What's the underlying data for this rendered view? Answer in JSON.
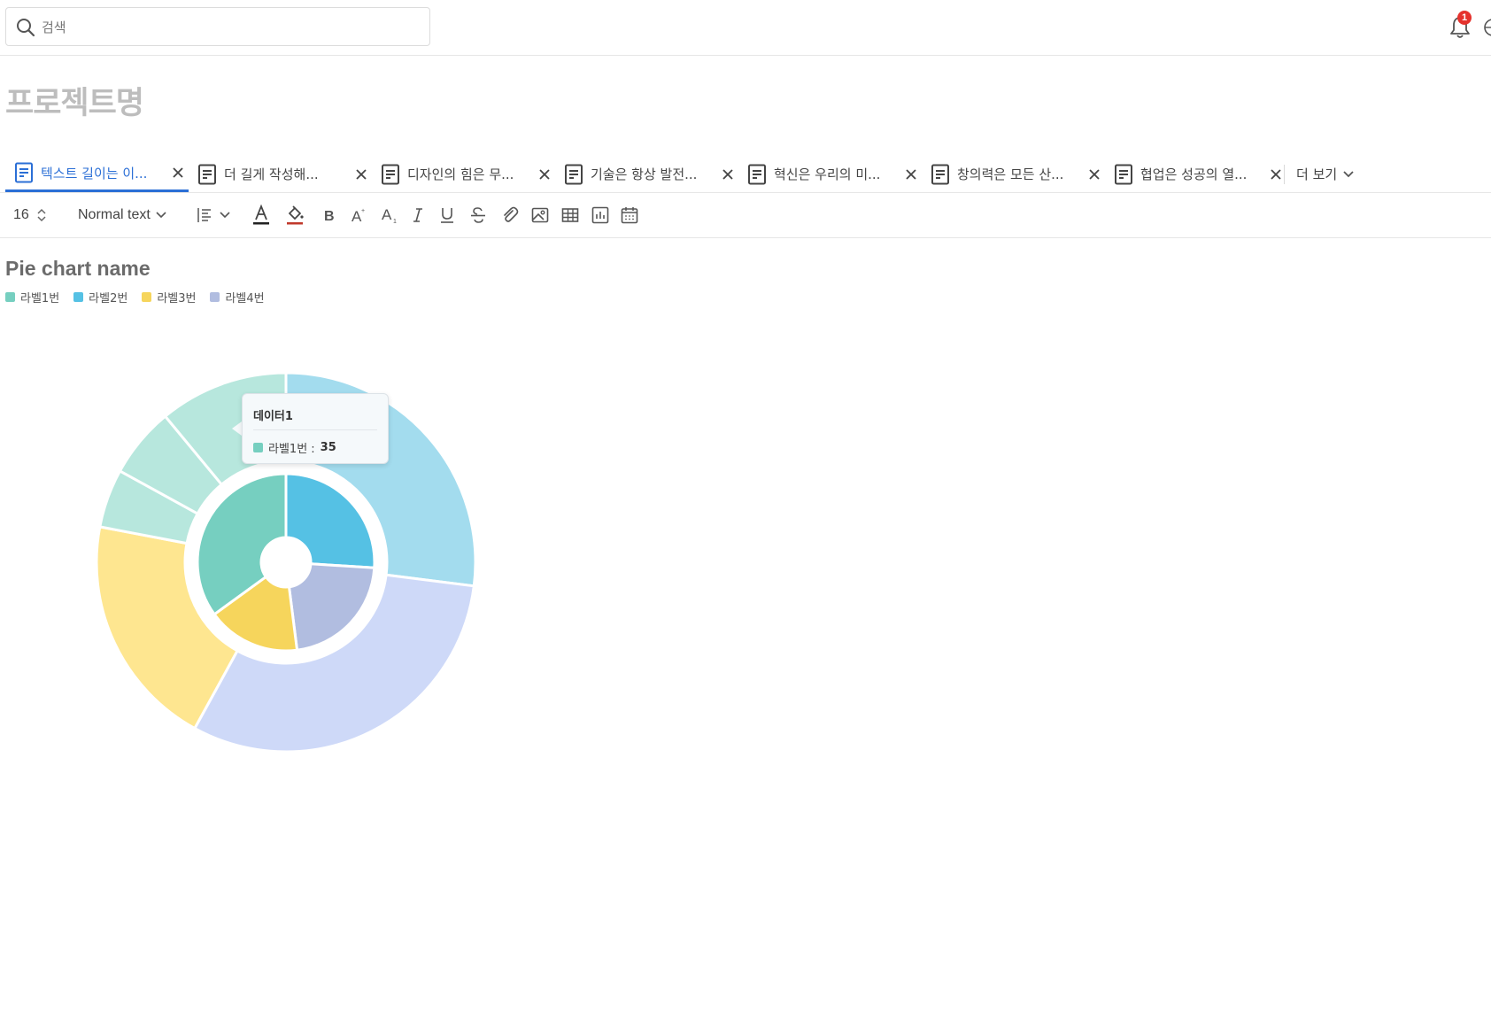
{
  "search": {
    "placeholder": "검색"
  },
  "notifications": {
    "count": "1"
  },
  "project": {
    "title": "프로젝트명"
  },
  "tabs": [
    {
      "label": "텍스트 길이는 이...",
      "active": true
    },
    {
      "label": "더 길게 작성해...",
      "active": false
    },
    {
      "label": "디자인의 힘은 무...",
      "active": false
    },
    {
      "label": "기술은 항상 발전...",
      "active": false
    },
    {
      "label": "혁신은 우리의 미...",
      "active": false
    },
    {
      "label": "창의력은 모든 산...",
      "active": false
    },
    {
      "label": "협업은 성공의 열...",
      "active": false
    }
  ],
  "more_tabs_label": "더 보기",
  "toolbar": {
    "font_size": "16",
    "text_style": "Normal text",
    "text_color": "#222222",
    "highlight_color": "#c0392b"
  },
  "chart_data": {
    "type": "pie",
    "title": "Pie chart name",
    "legend": [
      {
        "name": "라벨1번",
        "color": "#76cfc0"
      },
      {
        "name": "라벨2번",
        "color": "#55c1e4"
      },
      {
        "name": "라벨3번",
        "color": "#f6d55c"
      },
      {
        "name": "라벨4번",
        "color": "#b1bde0"
      }
    ],
    "inner_ring": [
      {
        "name": "라벨2번",
        "value": 26,
        "color": "#55c1e4"
      },
      {
        "name": "라벨4번",
        "value": 22,
        "color": "#b1bde0"
      },
      {
        "name": "라벨3번",
        "value": 17,
        "color": "#f6d55c"
      },
      {
        "name": "라벨1번",
        "value": 35,
        "color": "#76cfc0"
      }
    ],
    "outer_ring": [
      {
        "name": "라벨2번",
        "value": 27,
        "color": "#a3dcee"
      },
      {
        "name": "라벨4번",
        "value": 31,
        "color": "#ced9f8"
      },
      {
        "name": "라벨3번",
        "value": 20,
        "color": "#fee690"
      },
      {
        "name": "라벨1번",
        "value": 5,
        "color": "#b7e7dd"
      },
      {
        "name": "라벨1번",
        "value": 6,
        "color": "#b7e7dd"
      },
      {
        "name": "라벨1번",
        "value": 11,
        "color": "#b7e7dd"
      }
    ],
    "tooltip": {
      "title": "데이터1",
      "label": "라벨1번 :",
      "value": "35",
      "color": "#76cfc0"
    }
  }
}
